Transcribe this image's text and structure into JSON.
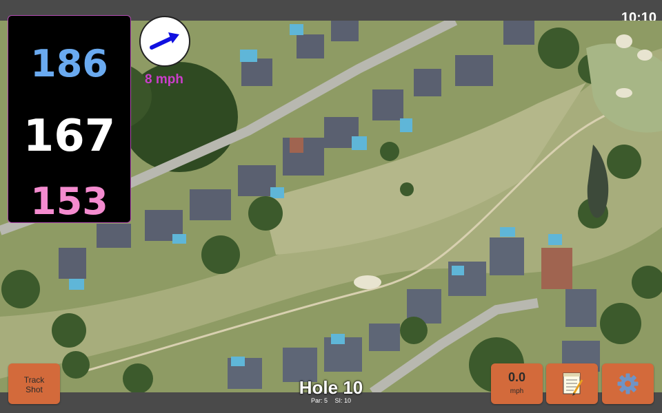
{
  "status_bar": {
    "time": "10:10"
  },
  "distances": {
    "back": "186",
    "middle": "167",
    "front": "153"
  },
  "wind": {
    "speed_label": "8 mph",
    "direction": "east-northeast",
    "arrow_color": "#1010e0"
  },
  "buttons": {
    "track_shot_line1": "Track",
    "track_shot_line2": "Shot",
    "speed_value": "0.0",
    "speed_unit": "mph",
    "notes_icon": "notepad-icon",
    "settings_icon": "gear-icon"
  },
  "hole": {
    "title": "Hole 10",
    "par": "Par: 5",
    "si": "SI: 10"
  },
  "colors": {
    "back_distance": "#6aaaf0",
    "middle_distance": "#ffffff",
    "front_distance": "#f48bcf",
    "button": "#d36a3b",
    "wind_text": "#cb3ecb"
  },
  "map": {
    "view": "satellite"
  }
}
